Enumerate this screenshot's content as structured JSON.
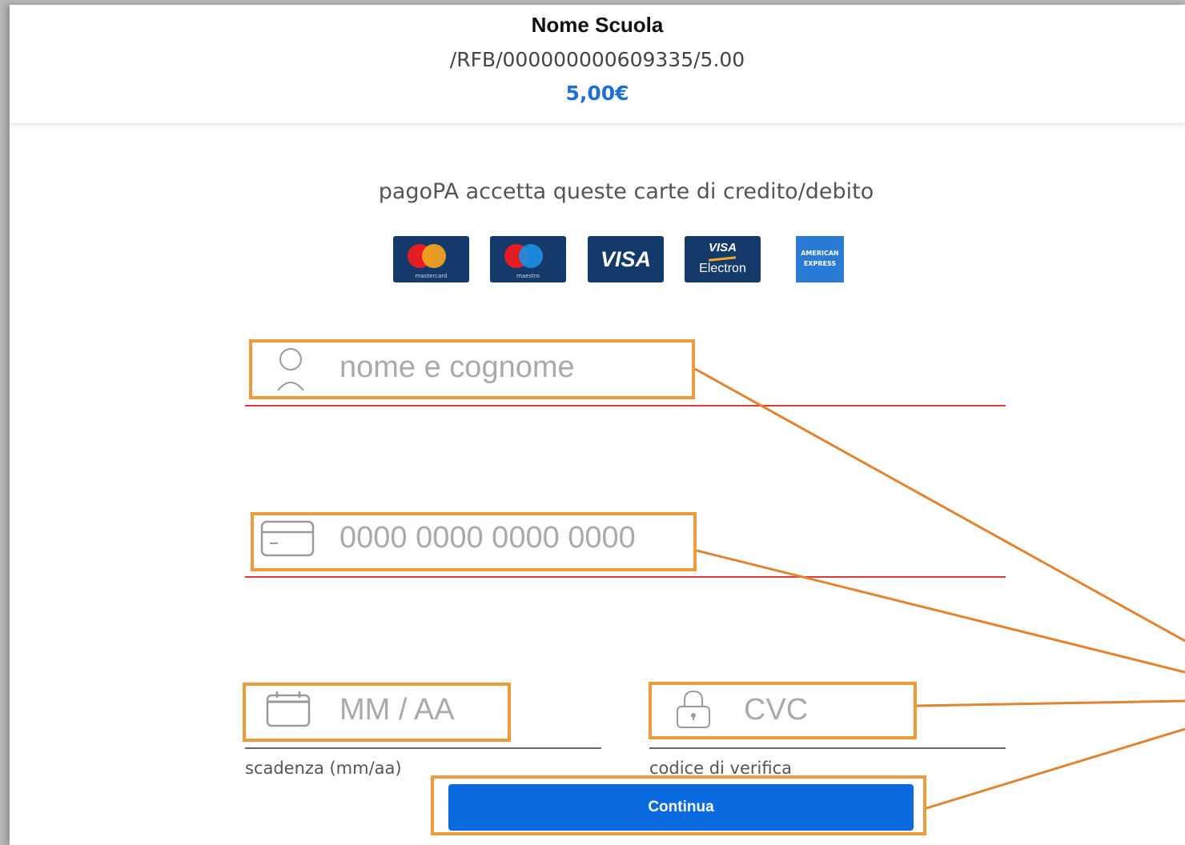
{
  "header": {
    "title": "Nome Scuola",
    "reference": "/RFB/000000000609335/5.00",
    "amount": "5,00€"
  },
  "accepted_cards": {
    "label": "pagoPA accetta queste carte di credito/debito",
    "cards": [
      {
        "name": "mastercard",
        "caption": "mastercard"
      },
      {
        "name": "maestro",
        "caption": "maestro"
      },
      {
        "name": "visa",
        "text": "VISA"
      },
      {
        "name": "visa-electron",
        "text_top": "VISA",
        "text_bottom": "Electron"
      },
      {
        "name": "american-express",
        "text_top": "AMERICAN",
        "text_bottom": "EXPRESS"
      }
    ]
  },
  "form": {
    "name_placeholder": "nome e cognome",
    "card_placeholder": "0000 0000 0000 0000",
    "expiry_placeholder": "MM / AA",
    "expiry_label": "scadenza (mm/aa)",
    "cvc_placeholder": "CVC",
    "cvc_label": "codice di verifica",
    "submit_label": "Continua"
  },
  "colors": {
    "accent": "#0a6ae0",
    "amount": "#1e6fd9",
    "error_line": "#e53935",
    "highlight": "#ef9a3b"
  },
  "icons": [
    "user-icon",
    "credit-card-icon",
    "calendar-icon",
    "lock-icon"
  ]
}
